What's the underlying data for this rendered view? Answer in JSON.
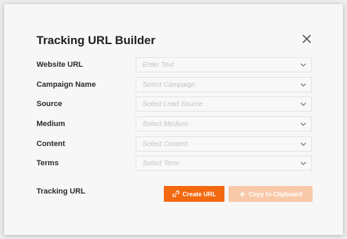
{
  "dialog": {
    "title": "Tracking URL Builder",
    "close_icon": "close-icon"
  },
  "fields": [
    {
      "label": "Website URL",
      "placeholder": "Enter Text"
    },
    {
      "label": "Campaign Name",
      "placeholder": "Select Campaign"
    },
    {
      "label": "Source",
      "placeholder": "Select Lead Source"
    },
    {
      "label": "Medium",
      "placeholder": "Select Medium"
    },
    {
      "label": "Content",
      "placeholder": "Select Content"
    },
    {
      "label": "Terms",
      "placeholder": "Select Term"
    }
  ],
  "footer": {
    "label": "Tracking URL",
    "create_button": "Create URL",
    "copy_button": "Copy to Clipboard"
  },
  "colors": {
    "accent": "#f3690f",
    "accent_disabled": "#f8c9a9"
  }
}
